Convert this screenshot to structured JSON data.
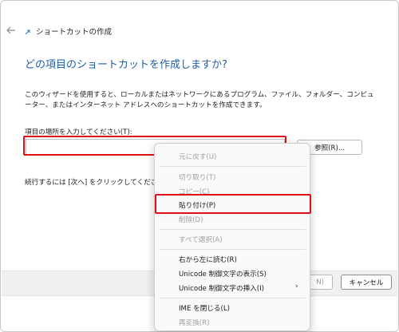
{
  "window": {
    "title": "ショートカットの作成",
    "heading": "どの項目のショートカットを作成しますか?",
    "description": "このウィザードを使用すると、ローカルまたはネットワークにあるプログラム、ファイル、フォルダー、コンピューター、またはインターネット アドレスへのショートカットを作成できます。",
    "location_label": "項目の場所を入力してください(T):",
    "location_value": "",
    "browse_label": "参照(R)...",
    "continue_text": "続行するには [次へ] をクリックしてください。",
    "next_label": "N)",
    "cancel_label": "キャンセル"
  },
  "context_menu": {
    "undo": "元に戻す(U)",
    "cut": "切り取り(T)",
    "copy": "コピー(C)",
    "paste": "貼り付け(P)",
    "delete": "削除(D)",
    "select_all": "すべて選択(A)",
    "rtl": "右から左に読む(R)",
    "show_unicode": "Unicode 制御文字の表示(S)",
    "insert_unicode": "Unicode 制御文字の挿入(I)",
    "submenu_arrow": "›",
    "close_ime": "IME を閉じる(L)",
    "reconvert": "再変換(R)"
  },
  "colors": {
    "heading": "#1f5fa6",
    "highlight": "#e0101b",
    "input_underline": "#2a60b8"
  },
  "icons": {
    "back": "back-arrow-icon",
    "title": "shortcut-icon"
  }
}
